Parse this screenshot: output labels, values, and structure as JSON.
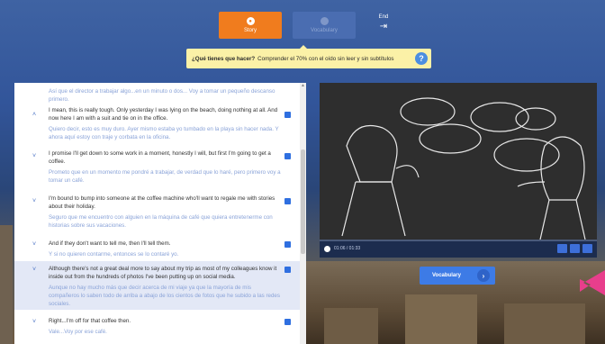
{
  "steps": [
    {
      "label": "Story",
      "state": "active",
      "icon": "circle-icon"
    },
    {
      "label": "Vocabulary",
      "state": "inactive",
      "icon": "circle-icon"
    }
  ],
  "end": {
    "label": "End",
    "icon": "exit-arrow-icon"
  },
  "instruction": {
    "bold": "¿Qué tienes que hacer?",
    "text": "Comprender el 70% con el oído sin leer y sin subtítulos",
    "help_icon": "question-icon"
  },
  "transcript": [
    {
      "en": "",
      "es": "Así que el director a trabajar algo...en un minuto o dos... Voy a tomar un pequeño descanso primero.",
      "highlight": false
    },
    {
      "en": "I mean, this is really tough. Only yesterday I was lying on the beach, doing nothing at all. And now here I am with a suit and tie on in the office.",
      "es": "Quiero decir, esto es muy duro. Ayer mismo estaba yo tumbado en la playa sin hacer nada. Y ahora aquí estoy con traje y corbata en la oficina.",
      "highlight": false
    },
    {
      "en": "I promise I'll get down to some work in a moment, honestly I will, but first I'm going to get a coffee.",
      "es": "Prometo que en un momento me pondré a trabajar, de verdad que lo haré, pero primero voy a tomar un café.",
      "highlight": false
    },
    {
      "en": "I'm bound to bump into someone at the coffee machine who'll want to regale me with stories about their holiday.",
      "es": "Seguro que me encuentro con alguien en la máquina de café que quiera entretenerme con historias sobre sus vacaciones.",
      "highlight": false
    },
    {
      "en": "And if they don't want to tell me, then I'll tell them.",
      "es": "Y si no quieren contarme, entonces se lo contaré yo.",
      "highlight": false
    },
    {
      "en": "Although there's not a great deal more to say about my trip as most of my colleagues know it inside out from the hundreds of photos I've been putting up on social media.",
      "es": "Aunque no hay mucho más que decir acerca de mi viaje ya que la mayoría de mis compañeros lo saben todo de arriba a abajo de los cientos de fotos que he subido a las redes sociales.",
      "highlight": true
    },
    {
      "en": "Right...I'm off for that coffee then.",
      "es": "Vale...Voy por ese café.",
      "highlight": false
    }
  ],
  "player": {
    "time": "01:06 / 01:33",
    "progress": 0.72
  },
  "vocab_button": {
    "label": "Vocabulary",
    "icon": "chevron-right-icon"
  },
  "colors": {
    "accent": "#f07c1e",
    "primary": "#3d7be6",
    "instruction_bg": "#fbf1a7"
  }
}
